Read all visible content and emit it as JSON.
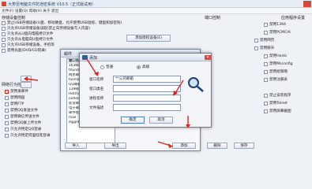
{
  "window": {
    "title": "大势至电脑文件防泄密系统 V10.5（正式版试用）",
    "menu": "文件(F)  设置(Q)  帮助(H)  关于  退出"
  },
  "left": {
    "group_title": "存储设备控制",
    "items": [
      "禁止USB存储设备(U盘、移动硬盘，允许使用USB鼠标，键盘和加密狗)",
      "只允许USB存储设备读取(禁止向存储设备写入内容)",
      "只允许从U盘向电脑拷贝文件",
      "只允许从电脑向U盘拷贝文件",
      "只允许USB存储设备，手机等",
      "禁用光驱(DVD/CD刻录)"
    ],
    "add_auth_btn": "添加授权设备(E)",
    "network_title": "网络行为控制",
    "network_items": [
      "禁用发邮件",
      "禁用网盘",
      "禁用FTP",
      "禁用QQ发送文件",
      "禁用微信传送文件",
      "禁用QQ群上传文件",
      "只允许特定QQ登录",
      "只允许特定阿里旺旺登录"
    ]
  },
  "right": {
    "group_title": "端口控制",
    "items": [
      "禁用1394",
      "禁用PCMCIA",
      "禁用Hosts",
      "禁用Msconfig",
      "禁用组策略",
      "禁用注册表",
      "禁止安装程序",
      "禁用Telnet",
      "禁用屏幕截图"
    ],
    "app_section": "应用程序设置",
    "app_items": [
      "禁用网页",
      "禁用聊天"
    ]
  },
  "dialog_list": {
    "title": "邮件",
    "header": "窗口名字",
    "rows": [
      "163邮箱",
      "thunderbird",
      "网易邮箱",
      "foxmail",
      "QQ邮箱",
      "139邮箱",
      "Hotmail",
      "outlook",
      "新浪邮箱",
      "电子邮件",
      "邮件客户端",
      "mail",
      "zqjgnf"
    ],
    "buttons": [
      "导入",
      "导出",
      "添加",
      "删除",
      "保存"
    ]
  },
  "dialog_search": {
    "title": "添加",
    "radio_1": "普通",
    "radio_2": "高级",
    "fields": [
      {
        "label": "窗口名称",
        "value": "**公司邮箱"
      },
      {
        "label": "窗口类名",
        "value": ""
      },
      {
        "label": "进程名称",
        "value": ""
      },
      {
        "label": "文件描述",
        "value": ""
      }
    ],
    "ok": "确定",
    "cancel": "取消",
    "close": "✕"
  },
  "accent_colors": {
    "arrow": "#e0231e",
    "title_bar": "#d6dfec"
  }
}
